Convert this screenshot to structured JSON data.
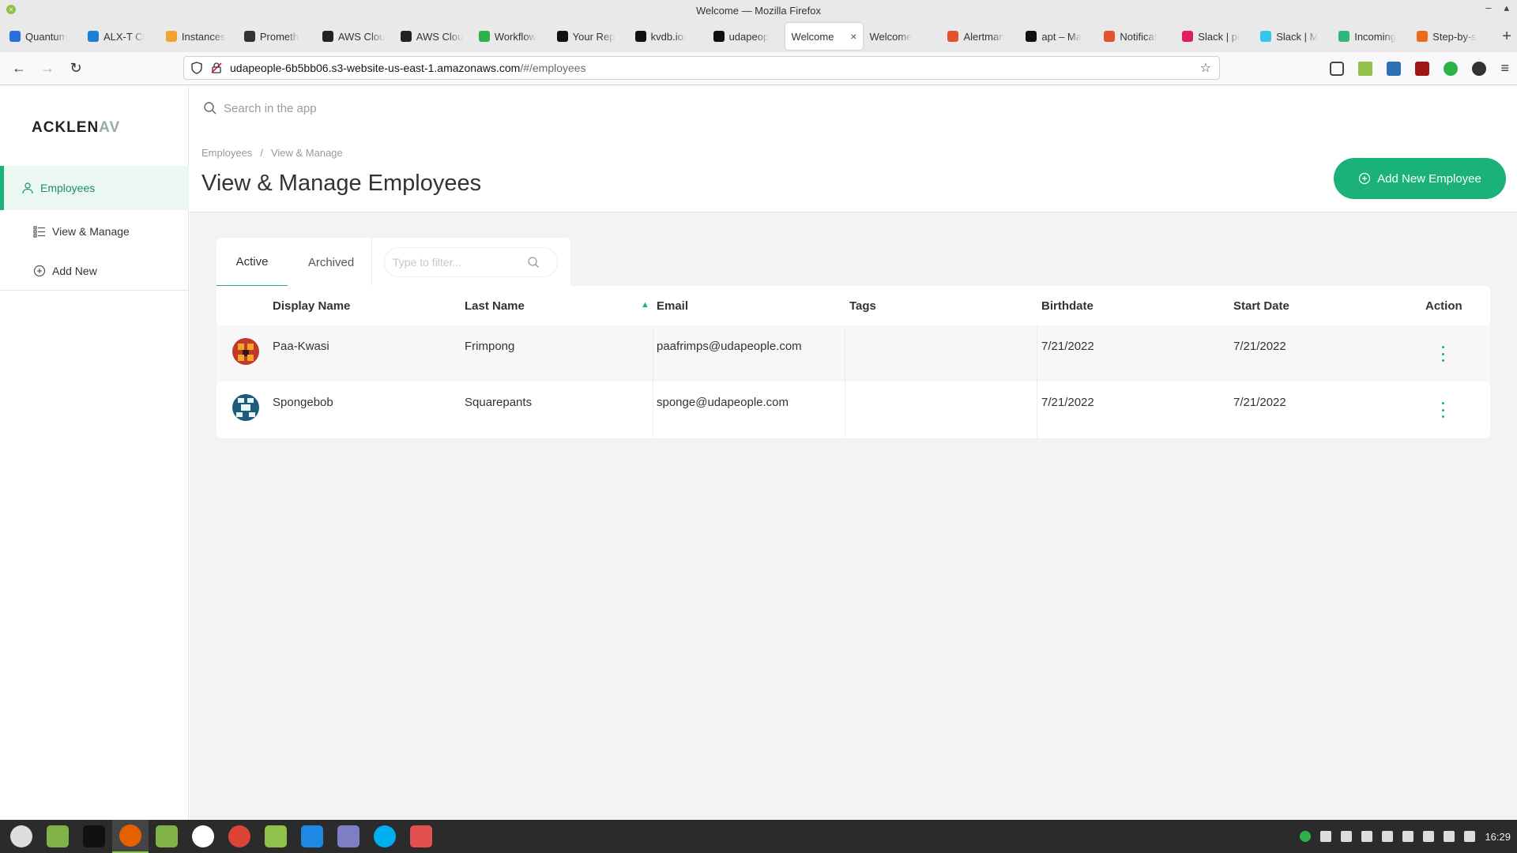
{
  "window": {
    "title": "Welcome — Mozilla Firefox",
    "close_symbol": "×",
    "minimize_symbol": "–",
    "maximize_symbol": "▴"
  },
  "browser_tabs": [
    {
      "label": "Quantum",
      "icon": "quantum-icon",
      "color": "#2a6fdb"
    },
    {
      "label": "ALX-T Cl",
      "icon": "udacity-icon",
      "color": "#1c7ed6"
    },
    {
      "label": "Instances",
      "icon": "aws-box-icon",
      "color": "#f0a430"
    },
    {
      "label": "Prometh",
      "icon": "terminal-icon",
      "color": "#333333"
    },
    {
      "label": "AWS Clou",
      "icon": "aws-console-icon",
      "color": "#222222"
    },
    {
      "label": "AWS Clou",
      "icon": "aws-console-icon",
      "color": "#222222"
    },
    {
      "label": "Workflow",
      "icon": "circleci-icon",
      "color": "#2cb14a"
    },
    {
      "label": "Your Rep",
      "icon": "github-icon",
      "color": "#111111"
    },
    {
      "label": "kvdb.io/",
      "icon": "kvdb-icon",
      "color": "#111111"
    },
    {
      "label": "udapeop",
      "icon": "github-icon",
      "color": "#111111"
    },
    {
      "label": "Welcome",
      "icon": "",
      "color": "#ffffff",
      "active": true
    },
    {
      "label": "Welcome",
      "icon": "",
      "color": "#e9e9e9"
    },
    {
      "label": "Alertman",
      "icon": "alertmanager-icon",
      "color": "#e6522c"
    },
    {
      "label": "apt – Ma",
      "icon": "arch-a-icon",
      "color": "#111111"
    },
    {
      "label": "Notificat",
      "icon": "bell-icon",
      "color": "#e6522c"
    },
    {
      "label": "Slack | pi",
      "icon": "slack-icon",
      "color": "#e01e5a"
    },
    {
      "label": "Slack | M",
      "icon": "slack-icon",
      "color": "#36c5f0"
    },
    {
      "label": "Incoming",
      "icon": "slack-icon",
      "color": "#2eb67d"
    },
    {
      "label": "Step-by-s",
      "icon": "settings-orange-icon",
      "color": "#f06a1a"
    }
  ],
  "active_tab_close": "×",
  "new_tab_symbol": "+",
  "nav": {
    "back_symbol": "←",
    "forward_symbol": "→",
    "reload_symbol": "↻",
    "url_host": "udapeople-6b5bb06.s3-website-us-east-1.amazonaws.com",
    "url_path": "/#/employees",
    "bookmark_symbol": "☆",
    "menu_symbol": "≡"
  },
  "app": {
    "logo_main": "ACKLEN",
    "logo_fade": "AV",
    "search_placeholder": "Search in the app",
    "sidebar": [
      {
        "label": "Employees",
        "icon": "user-icon",
        "active": true
      },
      {
        "label": "View & Manage",
        "icon": "list-icon"
      },
      {
        "label": "Add New",
        "icon": "plus-circle-icon"
      }
    ],
    "breadcrumb": [
      "Employees",
      "/",
      "View & Manage"
    ],
    "page_title": "View & Manage Employees",
    "add_button_label": "Add New Employee",
    "tabs": [
      "Active",
      "Archived"
    ],
    "filter_placeholder": "Type to filter...",
    "table": {
      "columns": [
        "Display Name",
        "Last Name",
        "Email",
        "Tags",
        "Birthdate",
        "Start Date",
        "Action"
      ],
      "sort_indicator": "▲",
      "rows": [
        {
          "display_name": "Paa-Kwasi",
          "last_name": "Frimpong",
          "email": "paafrimps@udapeople.com",
          "tags": "",
          "birthdate": "7/21/2022",
          "start_date": "7/21/2022",
          "avatar_color": "#c0392b"
        },
        {
          "display_name": "Spongebob",
          "last_name": "Squarepants",
          "email": "sponge@udapeople.com",
          "tags": "",
          "birthdate": "7/21/2022",
          "start_date": "7/21/2022",
          "avatar_color": "#1d5c7a"
        }
      ]
    }
  },
  "taskbar": {
    "apps": [
      {
        "icon": "mint-menu-icon",
        "color": "#dddddd"
      },
      {
        "icon": "files-icon",
        "color": "#7fb347"
      },
      {
        "icon": "terminal-icon",
        "color": "#111111"
      },
      {
        "icon": "firefox-icon",
        "color": "#e66000",
        "active": true
      },
      {
        "icon": "folder-icon",
        "color": "#7fb347"
      },
      {
        "icon": "music-icon",
        "color": "#ffffff"
      },
      {
        "icon": "chrome-icon",
        "color": "#db4437"
      },
      {
        "icon": "app-grid-icon",
        "color": "#8fc14b"
      },
      {
        "icon": "vscode-icon",
        "color": "#1e88e5"
      },
      {
        "icon": "text-editor-icon",
        "color": "#7e7ec4"
      },
      {
        "icon": "skype-icon",
        "color": "#00aff0"
      },
      {
        "icon": "folder-red-icon",
        "color": "#e35050"
      }
    ],
    "clock": "16:29"
  },
  "colors": {
    "accent": "#1ab278",
    "title_bar": "#e9e9e9",
    "taskbar": "#2b2b2b"
  }
}
